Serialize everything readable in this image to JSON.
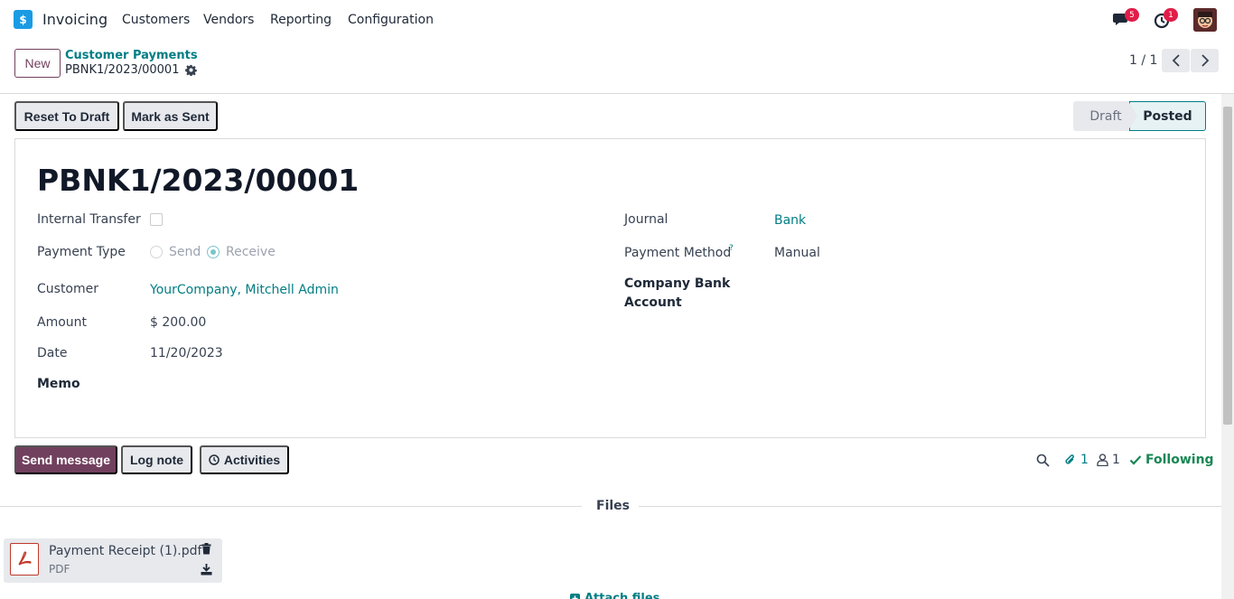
{
  "navbar": {
    "app_name": "Invoicing",
    "menu": [
      "Customers",
      "Vendors",
      "Reporting",
      "Configuration"
    ],
    "messages_count": "5",
    "activities_count": "1"
  },
  "control_panel": {
    "new_label": "New",
    "breadcrumb_parent": "Customer Payments",
    "breadcrumb_current": "PBNK1/2023/00001",
    "pager": "1 / 1"
  },
  "statusbar": {
    "buttons": [
      "Reset To Draft",
      "Mark as Sent"
    ],
    "stages": [
      "Draft",
      "Posted"
    ],
    "active_stage": "Posted"
  },
  "form": {
    "title": "PBNK1/2023/00001",
    "internal_transfer_label": "Internal Transfer",
    "internal_transfer_checked": false,
    "payment_type_label": "Payment Type",
    "payment_type_options": [
      "Send",
      "Receive"
    ],
    "payment_type_selected": "Receive",
    "customer_label": "Customer",
    "customer_value": "YourCompany, Mitchell Admin",
    "amount_label": "Amount",
    "amount_value": "$ 200.00",
    "date_label": "Date",
    "date_value": "11/20/2023",
    "memo_label": "Memo",
    "journal_label": "Journal",
    "journal_value": "Bank",
    "payment_method_label": "Payment Method",
    "payment_method_help": "?",
    "payment_method_value": "Manual",
    "company_bank_label_1": "Company Bank",
    "company_bank_label_2": "Account"
  },
  "chatter": {
    "send_message": "Send message",
    "log_note": "Log note",
    "activities": "Activities",
    "attachments_count": "1",
    "followers_count": "1",
    "following": "Following",
    "files_label": "Files",
    "attachment": {
      "name": "Payment Receipt (1).pdf",
      "type": "PDF"
    },
    "attach_files": "Attach files"
  },
  "colors": {
    "brand": "#71405e",
    "link": "#017e84",
    "following": "#198754",
    "badge": "#e11d48"
  }
}
